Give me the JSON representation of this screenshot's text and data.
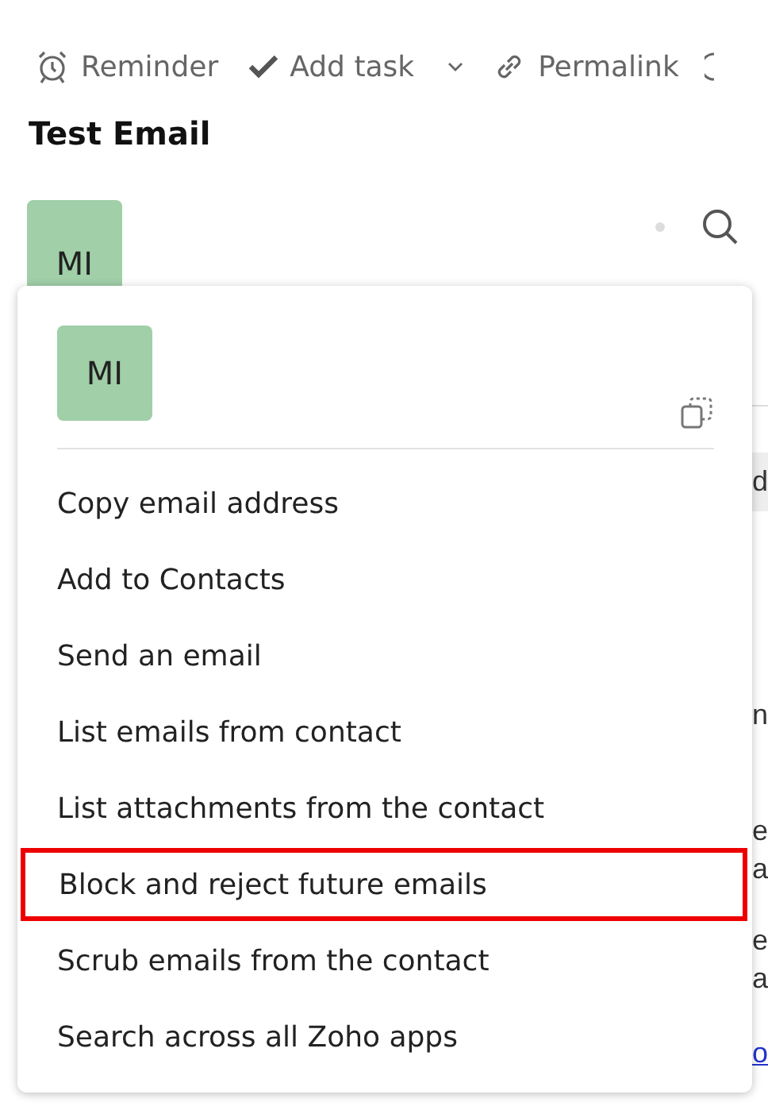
{
  "toolbar": [
    {
      "kind": "reminder",
      "label": "Reminder"
    },
    {
      "kind": "task",
      "label": "Add task"
    },
    {
      "kind": "link",
      "label": "Permalink"
    }
  ],
  "title": "Test Email",
  "sender": {
    "initials": "MI"
  },
  "background_fragments": [
    {
      "text": "d",
      "kind": "band"
    },
    {
      "text": "n",
      "kind": "plain"
    },
    {
      "text": "e",
      "kind": "plain"
    },
    {
      "text": "a",
      "kind": "plain"
    },
    {
      "text": "e",
      "kind": "plain"
    },
    {
      "text": "a",
      "kind": "plain"
    },
    {
      "text": "o",
      "kind": "link"
    }
  ],
  "popup": {
    "initials": "MI",
    "items": [
      {
        "label": "Copy email address",
        "selected": false
      },
      {
        "label": "Add to Contacts",
        "selected": false
      },
      {
        "label": "Send an email",
        "selected": false
      },
      {
        "label": "List emails from contact",
        "selected": false
      },
      {
        "label": "List attachments from the contact",
        "selected": false
      },
      {
        "label": "Block and reject future emails",
        "selected": true
      },
      {
        "label": "Scrub emails from the contact",
        "selected": false
      },
      {
        "label": "Search across all Zoho apps",
        "selected": false
      }
    ]
  }
}
